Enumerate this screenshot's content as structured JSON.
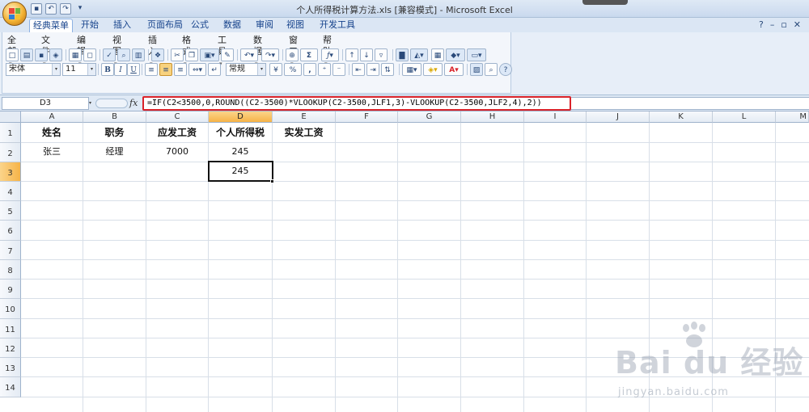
{
  "window": {
    "title": "个人所得税计算方法.xls  [兼容模式] - Microsoft Excel"
  },
  "ribbon_tabs": [
    {
      "label": "经典菜单",
      "active": true
    },
    {
      "label": "开始"
    },
    {
      "label": "插入"
    },
    {
      "label": "页面布局"
    },
    {
      "label": "公式"
    },
    {
      "label": "数据"
    },
    {
      "label": "审阅"
    },
    {
      "label": "视图"
    },
    {
      "label": "开发工具"
    }
  ],
  "menu": [
    "全部",
    "文件",
    "编辑",
    "视图",
    "插入",
    "格式",
    "工具",
    "数据",
    "窗口",
    "帮助"
  ],
  "toolbar": {
    "font_name": "宋体",
    "font_size": "11",
    "number_format": "常规",
    "bold": "B",
    "italic": "I",
    "underline": "U",
    "percent": "%",
    "comma": ",",
    "sum": "Σ",
    "font_color": "A"
  },
  "formula_bar": {
    "name_box": "D3",
    "fx_label": "fx",
    "formula": "=IF(C2<3500,0,ROUND((C2-3500)*VLOOKUP(C2-3500,JLF1,3)-VLOOKUP(C2-3500,JLF2,4),2))"
  },
  "columns": [
    "A",
    "B",
    "C",
    "D",
    "E",
    "F",
    "G",
    "H",
    "I",
    "J",
    "K",
    "L",
    "M"
  ],
  "rows": [
    "1",
    "2",
    "3",
    "4",
    "5",
    "6",
    "7",
    "8",
    "9",
    "10",
    "11",
    "12",
    "13",
    "14"
  ],
  "sheet": {
    "headers": [
      "姓名",
      "职务",
      "应发工资",
      "个人所得税",
      "实发工资"
    ],
    "row2": [
      "张三",
      "经理",
      "7000",
      "245",
      ""
    ],
    "row3_d": "245"
  },
  "selected_cell": "D3",
  "watermark": {
    "logo": "Bai du 经验",
    "url": "jingyan.baidu.com"
  },
  "colors": {
    "highlight_border": "#d9232a",
    "selected_header": "#f6b348",
    "ribbon_bg": "#dbe6f4"
  }
}
